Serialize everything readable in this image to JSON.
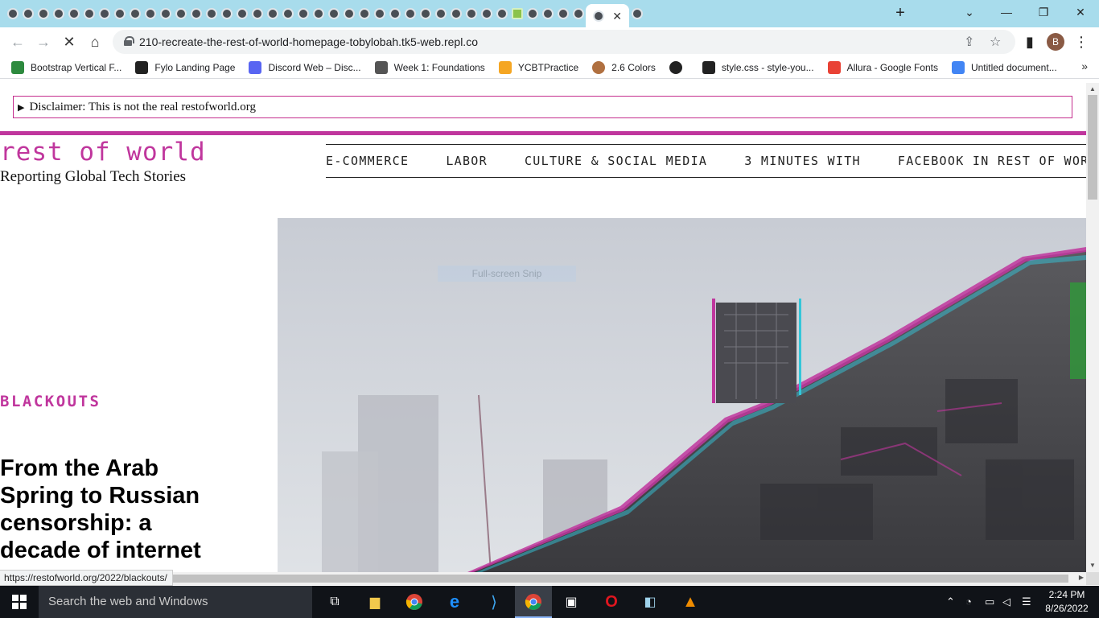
{
  "browser": {
    "tab_count_visible": 38,
    "active_tab_close": "✕",
    "new_tab": "+",
    "url": "210-recreate-the-rest-of-world-homepage-tobylobah.tk5-web.repl.co",
    "profile_initial": "B",
    "status_url": "https://restofworld.org/2022/blackouts/"
  },
  "bookmarks": [
    {
      "label": "Bootstrap Vertical F...",
      "icon": "bootstrap-icon",
      "color": "#2d8a3e"
    },
    {
      "label": "Fylo Landing Page",
      "icon": "codepen-icon",
      "color": "#222222"
    },
    {
      "label": "Discord Web – Disc...",
      "icon": "discord-icon",
      "color": "#5865f2"
    },
    {
      "label": "Week 1: Foundations",
      "icon": "tools-icon",
      "color": "#555555"
    },
    {
      "label": "YCBTPractice",
      "icon": "ycombinator-icon",
      "color": "#f5a623"
    },
    {
      "label": "2.6 Colors",
      "icon": "avatar-icon",
      "color": "#b07040"
    },
    {
      "label": "",
      "icon": "globe-icon",
      "color": "#222222"
    },
    {
      "label": "style.css - style-you...",
      "icon": "replit-icon",
      "color": "#222222"
    },
    {
      "label": "Allura - Google Fonts",
      "icon": "google-fonts-icon",
      "color": "#e94235"
    },
    {
      "label": "Untitled document...",
      "icon": "google-docs-icon",
      "color": "#4285f4"
    }
  ],
  "page": {
    "disclaimer": "Disclaimer: This is not the real restofworld.org",
    "logo": "rest of world",
    "tagline": "Reporting Global Tech Stories",
    "nav": [
      "E-COMMERCE",
      "LABOR",
      "CULTURE & SOCIAL MEDIA",
      "3 MINUTES WITH",
      "FACEBOOK IN REST OF WORLD"
    ],
    "kicker": "BLACKOUTS",
    "headline": "From the Arab Spring to Russian censorship: a decade of internet",
    "snip_overlay": "Full-screen Snip",
    "accent_color": "#c0369d"
  },
  "taskbar": {
    "search_placeholder": "Search the web and Windows",
    "time": "2:24 PM",
    "date": "8/26/2022"
  }
}
